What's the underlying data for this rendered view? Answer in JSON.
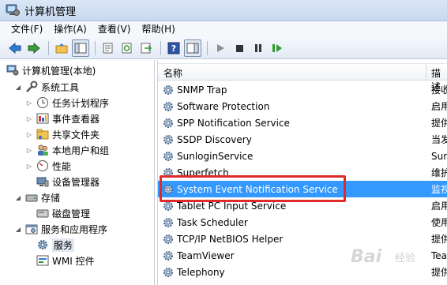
{
  "window": {
    "title": "计算机管理",
    "icon": "computer-management-icon"
  },
  "menu": [
    "文件(F)",
    "操作(A)",
    "查看(V)",
    "帮助(H)"
  ],
  "toolbar": {
    "buttons": [
      "back-icon",
      "forward-icon",
      "up-folder-icon",
      "show-tree-icon",
      "properties-icon",
      "refresh-icon",
      "export-icon",
      "help-icon",
      "show-action-pane-icon",
      "play-icon",
      "stop-icon",
      "pause-icon",
      "resume-icon"
    ]
  },
  "tree": {
    "root": "计算机管理(本地)",
    "items": [
      {
        "label": "系统工具",
        "level": 1,
        "icon": "tools-icon",
        "expanded": true
      },
      {
        "label": "任务计划程序",
        "level": 2,
        "icon": "clock-icon"
      },
      {
        "label": "事件查看器",
        "level": 2,
        "icon": "event-viewer-icon"
      },
      {
        "label": "共享文件夹",
        "level": 2,
        "icon": "shared-folder-icon"
      },
      {
        "label": "本地用户和组",
        "level": 2,
        "icon": "users-icon"
      },
      {
        "label": "性能",
        "level": 2,
        "icon": "performance-icon"
      },
      {
        "label": "设备管理器",
        "level": 2,
        "icon": "device-manager-icon"
      },
      {
        "label": "存储",
        "level": 1,
        "icon": "storage-icon",
        "expanded": true
      },
      {
        "label": "磁盘管理",
        "level": 2,
        "icon": "disk-icon"
      },
      {
        "label": "服务和应用程序",
        "level": 1,
        "icon": "services-apps-icon",
        "expanded": true
      },
      {
        "label": "服务",
        "level": 2,
        "icon": "gear-icon",
        "selected": true
      },
      {
        "label": "WMI 控件",
        "level": 2,
        "icon": "wmi-icon"
      }
    ]
  },
  "list": {
    "columns": {
      "name": "名称",
      "description": "描述"
    },
    "rows": [
      {
        "name": "SNMP Trap",
        "desc": "接收"
      },
      {
        "name": "Software Protection",
        "desc": "启用"
      },
      {
        "name": "SPP Notification Service",
        "desc": "提供"
      },
      {
        "name": "SSDP Discovery",
        "desc": "当发"
      },
      {
        "name": "SunloginService",
        "desc": "Sunlo"
      },
      {
        "name": "Superfetch",
        "desc": "维护"
      },
      {
        "name": "System Event Notification Service",
        "desc": "监视",
        "selected": true
      },
      {
        "name": "Tablet PC Input Service",
        "desc": "启用"
      },
      {
        "name": "Task Scheduler",
        "desc": "使用"
      },
      {
        "name": "TCP/IP NetBIOS Helper",
        "desc": "提供"
      },
      {
        "name": "TeamViewer",
        "desc": "Tea"
      },
      {
        "name": "Telephony",
        "desc": "提供"
      }
    ]
  },
  "watermark": {
    "brand": "Bai",
    "sub": "经验"
  },
  "colors": {
    "selection": "#3399ff",
    "highlight_box": "#e02a2a"
  }
}
